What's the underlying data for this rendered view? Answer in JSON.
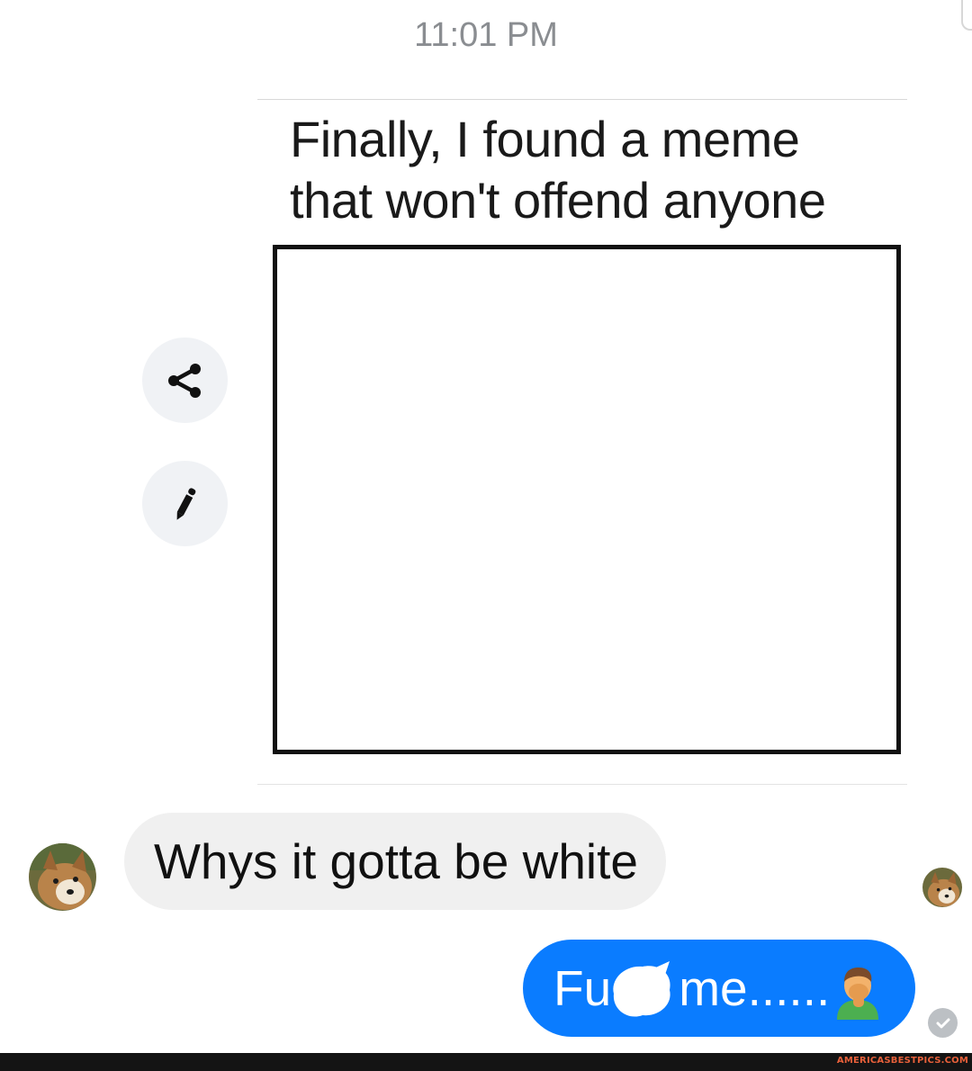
{
  "conversation": {
    "timestamp": "11:01 PM"
  },
  "shared_image": {
    "caption_line1": "Finally, I found a meme",
    "caption_line2": "that won't offend anyone"
  },
  "actions": {
    "share_icon": "share-icon",
    "edit_icon": "pencil-icon"
  },
  "messages": {
    "incoming_text": "Whys it gotta be white",
    "outgoing_prefix": "Fu",
    "outgoing_suffix": "me......",
    "outgoing_emoji": "man-facepalming-emoji",
    "outgoing_color": "#0a7cff",
    "incoming_color": "#f0f0f0"
  },
  "status": {
    "seen_icon": "check-circle-icon"
  },
  "watermark": {
    "text": "AMERICASBESTPICS.COM"
  }
}
